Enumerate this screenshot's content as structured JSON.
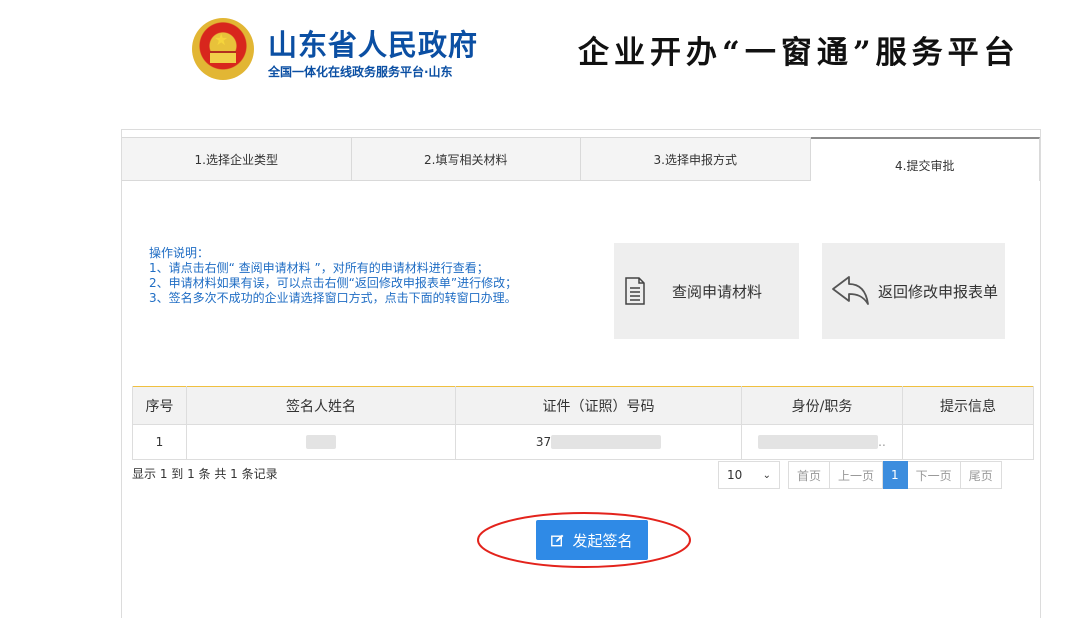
{
  "header": {
    "gov_title": "山东省人民政府",
    "gov_subtitle": "全国一体化在线政务服务平台·山东",
    "platform_title": "企业开办“一窗通”服务平台"
  },
  "steps": [
    {
      "label": "1.选择企业类型",
      "active": false
    },
    {
      "label": "2.填写相关材料",
      "active": false
    },
    {
      "label": "3.选择申报方式",
      "active": false
    },
    {
      "label": "4.提交审批",
      "active": true
    }
  ],
  "instructions": {
    "title": "操作说明：",
    "lines": [
      "1、请点击右侧“ 查阅申请材料 ”，对所有的申请材料进行查看；",
      "2、申请材料如果有误，可以点击右侧“返回修改申报表单”进行修改；",
      "3、签名多次不成功的企业请选择窗口方式，点击下面的转窗口办理。"
    ]
  },
  "actions": {
    "view_label": "查阅申请材料",
    "back_label": "返回修改申报表单"
  },
  "table": {
    "headers": [
      "序号",
      "签名人姓名",
      "证件（证照）号码",
      "身份/职务",
      "提示信息"
    ],
    "rows": [
      {
        "index": "1",
        "name": "",
        "id_prefix": "37",
        "role_suffix": "..",
        "tip": ""
      }
    ]
  },
  "records_text": "显示 1 到 1 条 共 1 条记录",
  "pager": {
    "page_size": "10",
    "first": "首页",
    "prev": "上一页",
    "current": "1",
    "next": "下一页",
    "last": "尾页"
  },
  "sign_button": "发起签名",
  "colors": {
    "brand_blue": "#0b4fa3",
    "link_blue": "#1f6dc4",
    "button_blue": "#2f8ae6",
    "highlight_red": "#e3231c"
  }
}
